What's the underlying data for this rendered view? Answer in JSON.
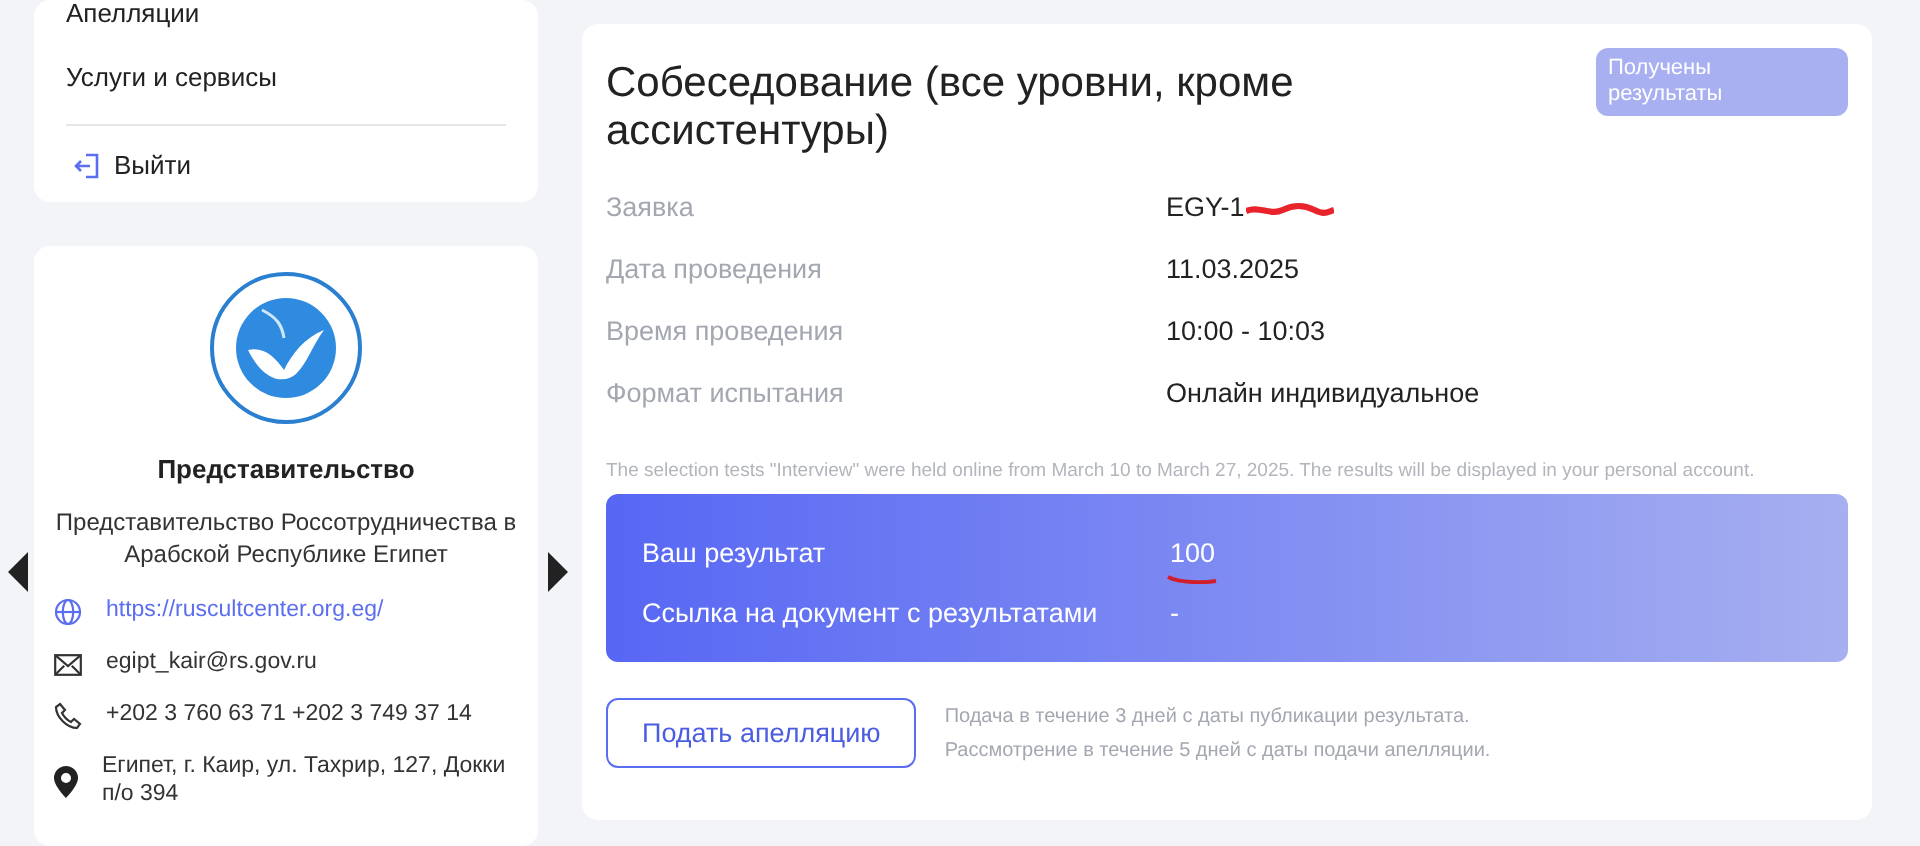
{
  "sidebar": {
    "menu": [
      "Апелляции",
      "Услуги и сервисы"
    ],
    "logout": "Выйти"
  },
  "office": {
    "title": "Представительство",
    "name": "Представительство Россотрудничества в Арабской Республике Египет",
    "contacts": [
      {
        "kind": "web",
        "text": "https://ruscultcenter.org.eg/"
      },
      {
        "kind": "email",
        "text": "egipt_kair@rs.gov.ru"
      },
      {
        "kind": "phone",
        "text": "+202 3 760 63 71 +202 3 749 37 14"
      },
      {
        "kind": "address",
        "text": "Египет, г. Каир, ул. Тахрир, 127, Докки п/о 394"
      }
    ]
  },
  "exam": {
    "title": "Собеседование (все уровни, кроме ассистентуры)",
    "status": "Получены результаты",
    "details": [
      {
        "label": "Заявка",
        "value": "EGY-1",
        "redacted": true
      },
      {
        "label": "Дата проведения",
        "value": "11.03.2025",
        "redacted": false
      },
      {
        "label": "Время проведения",
        "value": "10:00 - 10:03",
        "redacted": false
      },
      {
        "label": "Формат испытания",
        "value": "Онлайн индивидуальное",
        "redacted": false
      }
    ],
    "note": "The selection tests \"Interview\" were held online from March 10 to March 27, 2025. The results will be displayed in your personal account.",
    "results": [
      {
        "label": "Ваш результат",
        "value": "100",
        "underlined": true
      },
      {
        "label": "Ссылка на документ с результатами",
        "value": "-",
        "underlined": false
      }
    ],
    "appeal_button": "Подать апелляцию",
    "appeal_note": [
      "Подача в течение 3 дней с даты публикации результата.",
      "Рассмотрение в течение 5 дней с даты подачи апелляции."
    ]
  }
}
